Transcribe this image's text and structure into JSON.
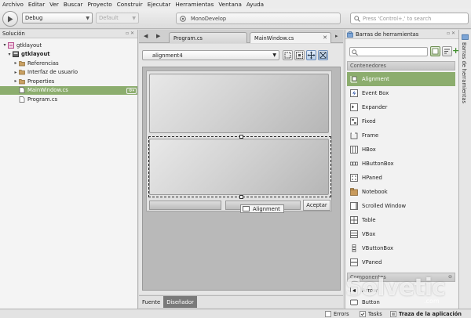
{
  "menu": [
    "Archivo",
    "Editar",
    "Ver",
    "Buscar",
    "Proyecto",
    "Construir",
    "Ejecutar",
    "Herramientas",
    "Ventana",
    "Ayuda"
  ],
  "toolbar": {
    "config_value": "Debug",
    "platform_value": "Default",
    "status_text": "MonoDevelop",
    "search_placeholder": "Press 'Control+,' to search"
  },
  "solution": {
    "title": "Solución",
    "items": [
      {
        "label": "gtklayout",
        "bold": false,
        "icon": "solution-icon"
      },
      {
        "label": "gtklayout",
        "bold": true,
        "icon": "project-icon"
      },
      {
        "label": "Referencias",
        "bold": false,
        "icon": "folder-icon"
      },
      {
        "label": "Interfaz de usuario",
        "bold": false,
        "icon": "folder-icon"
      },
      {
        "label": "Properties",
        "bold": false,
        "icon": "folder-icon"
      },
      {
        "label": "MainWindow.cs",
        "bold": false,
        "icon": "file-icon",
        "selected": true
      },
      {
        "label": "Program.cs",
        "bold": false,
        "icon": "file-icon"
      }
    ]
  },
  "tabs": [
    {
      "label": "Program.cs",
      "active": false
    },
    {
      "label": "MainWindow.cs",
      "active": true
    }
  ],
  "designer": {
    "widget_combo": "alignment4",
    "ok_label": "Aceptar",
    "tooltip": "Alignment",
    "view_tabs": [
      {
        "label": "Fuente",
        "active": false
      },
      {
        "label": "Diseñador",
        "active": true
      }
    ]
  },
  "toolbox": {
    "title": "Barras de herramientas",
    "vertical_label": "Barras de herramientas",
    "categories": [
      "Contenedores",
      "Componentes"
    ],
    "items": [
      {
        "label": "Alignment",
        "selected": true,
        "icon": "alignment-icon"
      },
      {
        "label": "Event Box",
        "icon": "eventbox-icon"
      },
      {
        "label": "Expander",
        "icon": "expander-icon"
      },
      {
        "label": "Fixed",
        "icon": "fixed-icon"
      },
      {
        "label": "Frame",
        "icon": "frame-icon"
      },
      {
        "label": "HBox",
        "icon": "hbox-icon"
      },
      {
        "label": "HButtonBox",
        "icon": "hbuttonbox-icon"
      },
      {
        "label": "HPaned",
        "icon": "hpaned-icon"
      },
      {
        "label": "Notebook",
        "icon": "notebook-icon"
      },
      {
        "label": "Scrolled Window",
        "icon": "scrolledwindow-icon"
      },
      {
        "label": "Table",
        "icon": "table-icon"
      },
      {
        "label": "VBox",
        "icon": "vbox-icon"
      },
      {
        "label": "VButtonBox",
        "icon": "vbuttonbox-icon"
      },
      {
        "label": "VPaned",
        "icon": "vpaned-icon"
      }
    ],
    "component_items": [
      {
        "label": "Arrow",
        "icon": "arrow-icon"
      },
      {
        "label": "Button",
        "icon": "button-icon"
      }
    ]
  },
  "statusbar": {
    "errors": "Errors",
    "tasks": "Tasks",
    "trace": "Traza de la aplicación"
  },
  "watermark": {
    "brand": "Solvetic",
    "domain": ".com"
  },
  "colors": {
    "selection": "#8cad6e"
  }
}
